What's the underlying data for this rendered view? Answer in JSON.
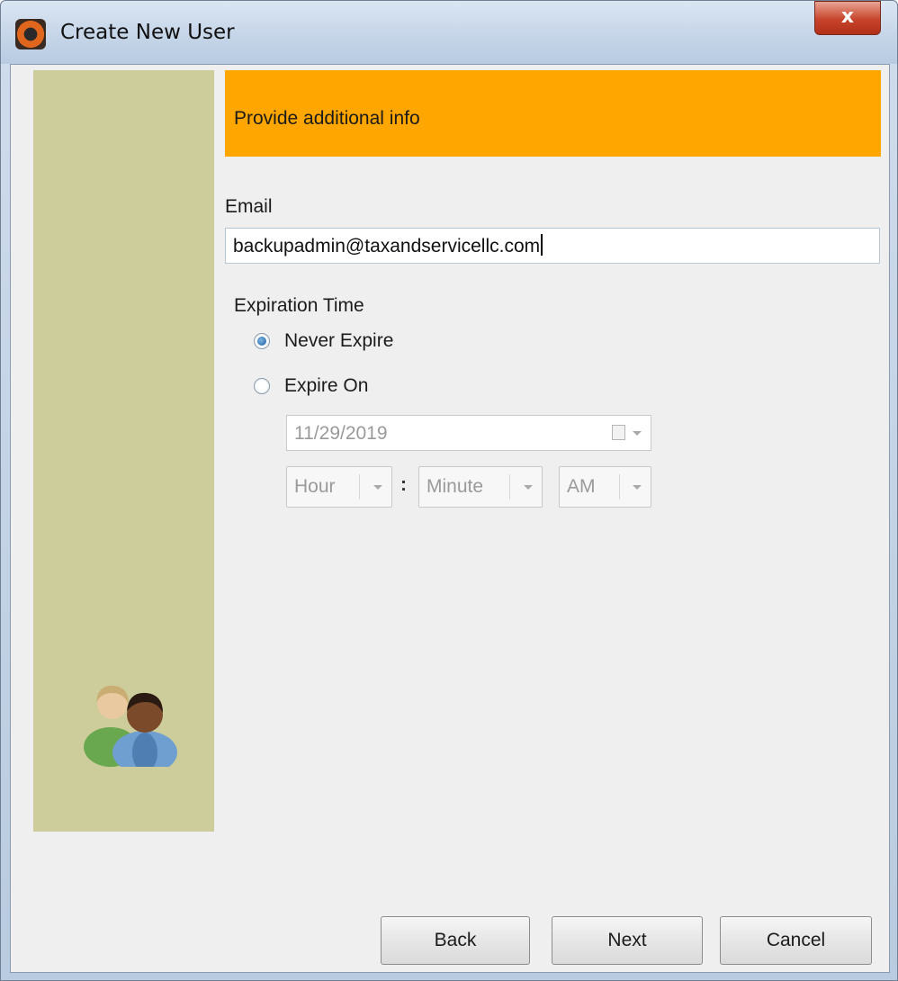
{
  "window": {
    "title": "Create New User",
    "close_glyph": "x",
    "app_icon": "app-logo-icon"
  },
  "sidebar": {
    "icon": "users-icon"
  },
  "banner": {
    "text": "Provide additional info",
    "color": "#ffa600"
  },
  "email": {
    "label": "Email",
    "value": "backupadmin@taxandservicellc.com"
  },
  "expiration": {
    "label": "Expiration Time",
    "options": [
      {
        "label": "Never Expire",
        "checked": true
      },
      {
        "label": "Expire On",
        "checked": false
      }
    ],
    "date": "11/29/2019",
    "hour": "Hour",
    "minute": "Minute",
    "ampm": "AM",
    "separator": ":"
  },
  "buttons": {
    "back": "Back",
    "next": "Next",
    "cancel": "Cancel"
  },
  "colors": {
    "sidebar": "#cdcc9b",
    "background": "#efefef"
  }
}
